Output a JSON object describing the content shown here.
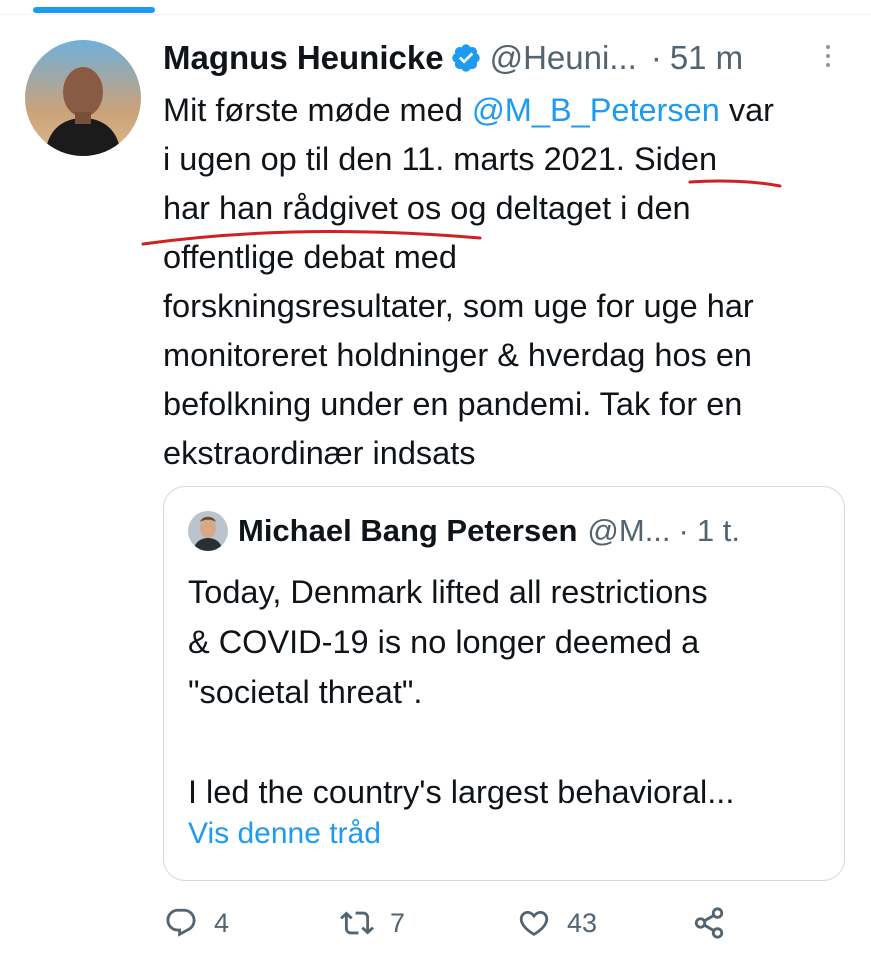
{
  "tweet": {
    "author_name": "Magnus Heunicke",
    "handle": "@Heuni...",
    "separator": "·",
    "time": "51 m",
    "text_before_mention": "Mit første møde med ",
    "mention": "@M_B_Petersen",
    "text_after_mention": " var",
    "lines": [
      "i ugen op til den 11. marts 2021. Siden",
      "har han rådgivet os og deltaget i den",
      "offentlige debat med",
      "forskningsresultater, som uge for uge har",
      "monitoreret holdninger & hverdag hos en",
      "befolkning under en pandemi. Tak for en",
      "ekstraordinær indsats"
    ],
    "annotation_color": "#d21f1f"
  },
  "quote": {
    "author_name": "Michael Bang Petersen",
    "handle": "@M...",
    "separator": "·",
    "time": "1 t.",
    "lines": [
      "Today, Denmark lifted all restrictions",
      "& COVID-19 is no longer deemed a",
      "\"societal threat\".",
      "",
      "I led the country's largest behavioral..."
    ],
    "show_thread": "Vis denne tråd"
  },
  "actions": {
    "replies": "4",
    "retweets": "7",
    "likes": "43",
    "icons": [
      "reply-icon",
      "retweet-icon",
      "like-icon",
      "share-icon"
    ]
  },
  "colors": {
    "accent": "#1d9bf0",
    "muted": "#536471",
    "border": "#cfd9de"
  }
}
